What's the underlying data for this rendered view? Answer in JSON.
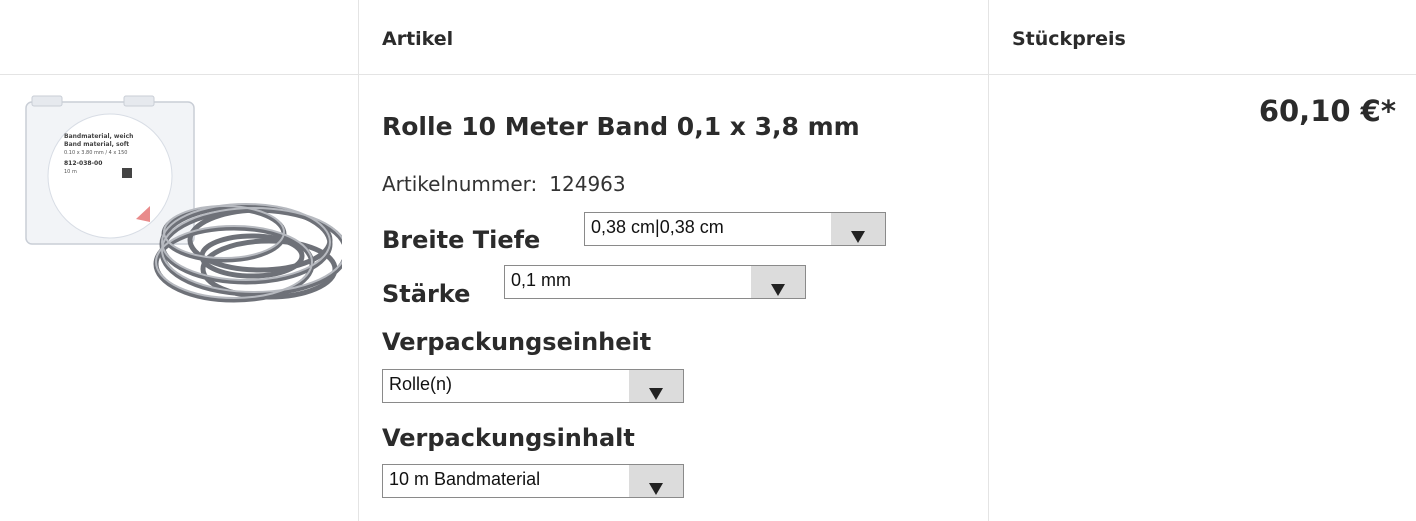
{
  "header": {
    "col_article": "Artikel",
    "col_unit_price": "Stückpreis"
  },
  "product": {
    "image_icon": "product-photo-band-material-roll",
    "image_text": {
      "line1": "Bandmaterial, weich",
      "line2": "Band material, soft",
      "line3": "0.10 x 3.80 mm / 4 x 150",
      "ref": "812-038-00",
      "length": "10 m"
    },
    "title": "Rolle 10 Meter Band 0,1 x 3,8 mm",
    "article_number_label": "Artikelnummer:",
    "article_number": "124963",
    "options": [
      {
        "label": "Breite Tiefe",
        "value": "0,38 cm|0,38 cm"
      },
      {
        "label": "Stärke",
        "value": "0,1 mm"
      },
      {
        "label": "Verpackungseinheit",
        "value": "Rolle(n)"
      },
      {
        "label": "Verpackungsinhalt",
        "value": "10 m Bandmaterial"
      }
    ],
    "price": "60,10 €*"
  }
}
